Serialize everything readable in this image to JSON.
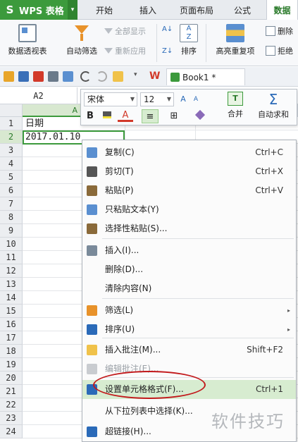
{
  "app": {
    "name": "WPS 表格",
    "logo_glyph": "S",
    "dropdown_glyph": "▾",
    "accent": "#3c9a3c"
  },
  "tabs": [
    {
      "label": "开始"
    },
    {
      "label": "插入"
    },
    {
      "label": "页面布局"
    },
    {
      "label": "公式"
    },
    {
      "label": "数据"
    }
  ],
  "ribbon": {
    "pivot": "数据透视表",
    "autofilter": "自动筛选",
    "show_all": "全部显示",
    "reapply": "重新应用",
    "sort": "排序",
    "highlight_dup": "高亮重复项",
    "delete": "删除",
    "reject": "拒绝"
  },
  "workbook": {
    "tab_label": "Book1 *"
  },
  "namebox": "A2",
  "mini_toolbar": {
    "font": "宋体",
    "size": "12",
    "bold": "B",
    "font_color": "A",
    "merge": "合并",
    "autosum": "自动求和",
    "merge_glyph": "T",
    "sum_glyph": "Σ"
  },
  "grid": {
    "col_a": "A",
    "rows": [
      "1",
      "2",
      "3",
      "4",
      "5",
      "6",
      "7",
      "8",
      "9",
      "10",
      "11",
      "12",
      "13",
      "14",
      "15",
      "16",
      "17",
      "18",
      "19",
      "20",
      "21",
      "22",
      "23",
      "24"
    ],
    "a1": "日期",
    "a2": "2017.01.10"
  },
  "context_menu": [
    {
      "label": "复制(C)",
      "shortcut": "Ctrl+C",
      "icon": "copy-icon"
    },
    {
      "label": "剪切(T)",
      "shortcut": "Ctrl+X",
      "icon": "scissors-icon"
    },
    {
      "label": "粘贴(P)",
      "shortcut": "Ctrl+V",
      "icon": "paste-icon"
    },
    {
      "label": "只粘贴文本(Y)",
      "shortcut": "",
      "icon": "paste-text-icon"
    },
    {
      "label": "选择性粘贴(S)...",
      "shortcut": "",
      "icon": "paste-special-icon"
    },
    {
      "label": "插入(I)...",
      "shortcut": "",
      "icon": "insert-icon"
    },
    {
      "label": "删除(D)...",
      "shortcut": "",
      "icon": ""
    },
    {
      "label": "清除内容(N)",
      "shortcut": "",
      "icon": ""
    },
    {
      "label": "筛选(L)",
      "shortcut": "",
      "icon": "filter-icon",
      "submenu": "▸"
    },
    {
      "label": "排序(U)",
      "shortcut": "",
      "icon": "sort-icon",
      "submenu": "▸"
    },
    {
      "label": "插入批注(M)...",
      "shortcut": "Shift+F2",
      "icon": "comment-icon"
    },
    {
      "label": "编辑批注(E)...",
      "shortcut": "",
      "icon": "edit-comment-icon",
      "disabled": true
    },
    {
      "label": "设置单元格格式(F)...",
      "shortcut": "Ctrl+1",
      "icon": "format-cells-icon"
    },
    {
      "label": "从下拉列表中选择(K)...",
      "shortcut": "",
      "icon": ""
    },
    {
      "label": "超链接(H)...",
      "shortcut": "",
      "icon": "hyperlink-icon"
    }
  ],
  "watermark": "软件技巧"
}
